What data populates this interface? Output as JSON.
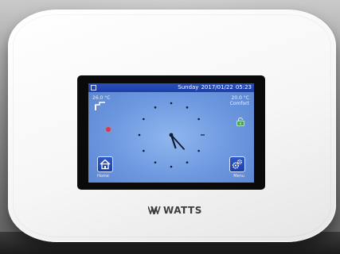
{
  "status_bar": {
    "day": "Sunday",
    "date": "2017/01/22",
    "time": "05:23"
  },
  "readings": {
    "left_temperature": "26.0 °C",
    "right_temperature": "20.0 °C",
    "right_mode": "Comfort"
  },
  "clock": {
    "hour": 5,
    "minute": 23
  },
  "buttons": {
    "home_label": "Home",
    "menu_label": "Menu"
  },
  "brand": {
    "logo_text": "WATTS"
  },
  "icons": {
    "status": "menu-icon",
    "setpoint": "setpoint-graph-icon",
    "heat": "heating-indicator-icon",
    "lock": "unlocked-padlock-icon",
    "home": "home-icon",
    "menu": "gears-icon"
  },
  "colors": {
    "status_bar": "#1d3da5",
    "screen": "#6c97df",
    "heat_indicator": "#d6394a",
    "lock": "#3fae4a",
    "device": "#f6f6f6"
  }
}
